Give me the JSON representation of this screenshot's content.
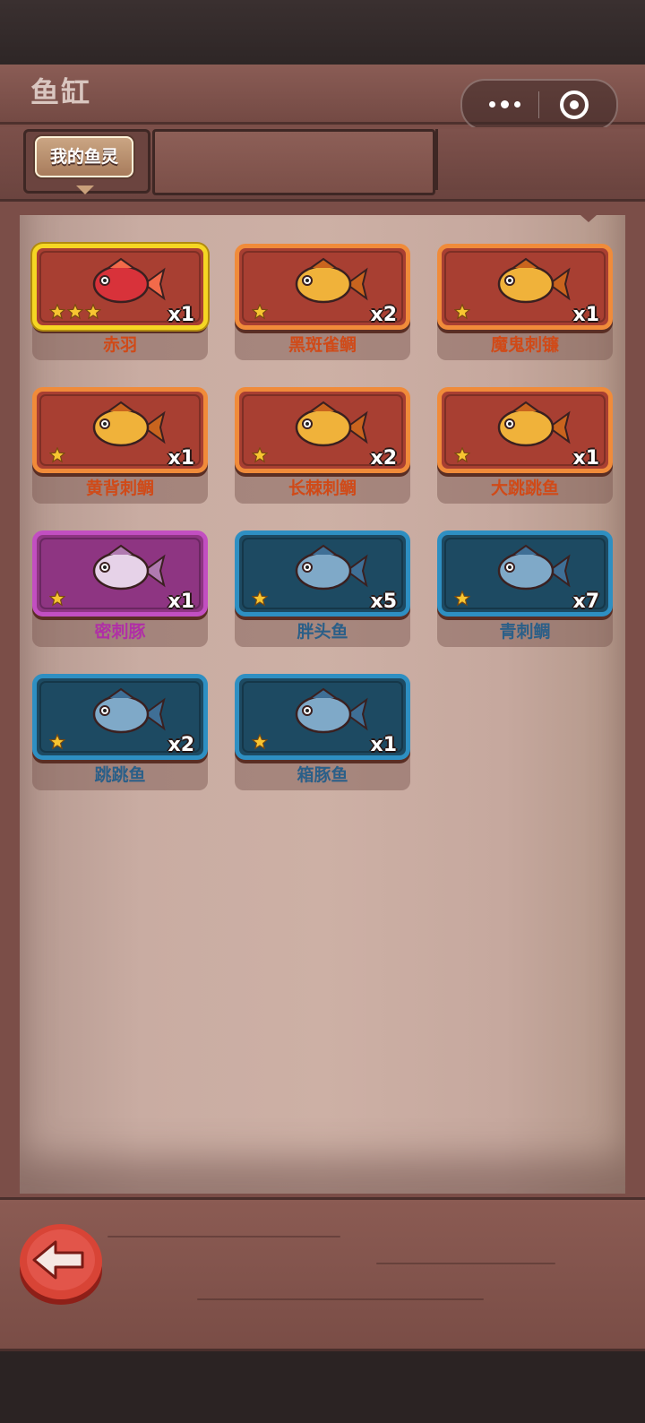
{
  "app": {
    "title": "鱼缸"
  },
  "capsule": {
    "more_icon": "more-dots-icon",
    "close_icon": "mini-program-close-icon"
  },
  "tabs": {
    "active_label": "我的鱼灵"
  },
  "colors": {
    "orange_frame": "#f08b3a",
    "gold_frame": "#f5d623",
    "purple_frame": "#c24fc1",
    "blue_frame": "#2e8fc2"
  },
  "fish": [
    {
      "name": "赤羽",
      "count": "x1",
      "stars": 3,
      "rarity": "gold",
      "icon": "red-fish-icon"
    },
    {
      "name": "黑斑雀鲷",
      "count": "x2",
      "stars": 1,
      "rarity": "orange",
      "icon": "lionfish-icon"
    },
    {
      "name": "魔鬼刺镰",
      "count": "x1",
      "stars": 1,
      "rarity": "orange",
      "icon": "moorish-idol-icon"
    },
    {
      "name": "黄背刺鲷",
      "count": "x1",
      "stars": 1,
      "rarity": "orange",
      "icon": "yellow-fish-icon"
    },
    {
      "name": "长棘刺鲷",
      "count": "x2",
      "stars": 1,
      "rarity": "orange",
      "icon": "spiny-yellow-fish-icon"
    },
    {
      "name": "大跳跳鱼",
      "count": "x1",
      "stars": 1,
      "rarity": "orange",
      "icon": "mudskipper-icon"
    },
    {
      "name": "密刺豚",
      "count": "x1",
      "stars": 1,
      "rarity": "purple",
      "icon": "pufferfish-icon"
    },
    {
      "name": "胖头鱼",
      "count": "x5",
      "stars": 1,
      "rarity": "blue",
      "icon": "round-blue-fish-icon"
    },
    {
      "name": "青刺鲷",
      "count": "x7",
      "stars": 1,
      "rarity": "blue",
      "icon": "blue-spiny-fish-icon"
    },
    {
      "name": "跳跳鱼",
      "count": "x2",
      "stars": 1,
      "rarity": "blue",
      "icon": "grey-fish-icon"
    },
    {
      "name": "箱豚鱼",
      "count": "x1",
      "stars": 1,
      "rarity": "blue",
      "icon": "boxfish-icon"
    }
  ],
  "footer": {
    "back_icon": "back-arrow-icon"
  }
}
